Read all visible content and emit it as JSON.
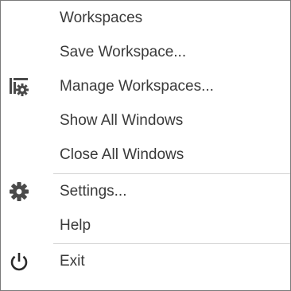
{
  "menu": {
    "items": [
      {
        "label": "Workspaces",
        "icon": ""
      },
      {
        "label": "Save Workspace...",
        "icon": ""
      },
      {
        "label": "Manage Workspaces...",
        "icon": "manage-workspaces-icon"
      },
      {
        "label": "Show All Windows",
        "icon": ""
      },
      {
        "label": "Close All Windows",
        "icon": ""
      },
      {
        "label": "Settings...",
        "icon": "gear-icon"
      },
      {
        "label": "Help",
        "icon": ""
      },
      {
        "label": "Exit",
        "icon": "power-icon"
      }
    ]
  },
  "colors": {
    "text": "#3a3a3a",
    "icon": "#4a4a4a",
    "border": "#7a7a7a",
    "separator": "#d4d4d4"
  }
}
